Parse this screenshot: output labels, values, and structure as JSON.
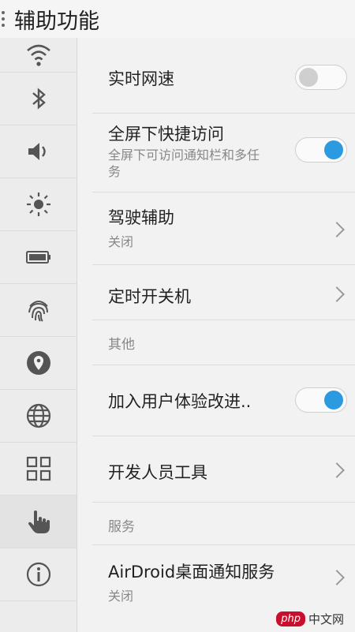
{
  "header": {
    "title": "辅助功能"
  },
  "sidebar": {
    "items": [
      {
        "icon": "wifi-icon"
      },
      {
        "icon": "bluetooth-icon"
      },
      {
        "icon": "volume-icon"
      },
      {
        "icon": "brightness-icon"
      },
      {
        "icon": "battery-icon"
      },
      {
        "icon": "fingerprint-icon"
      },
      {
        "icon": "location-icon"
      },
      {
        "icon": "globe-icon"
      },
      {
        "icon": "apps-grid-icon"
      },
      {
        "icon": "hand-pointer-icon",
        "active": true
      },
      {
        "icon": "info-icon"
      }
    ]
  },
  "rows": {
    "realtime_speed": {
      "label": "实时网速",
      "toggle": "off"
    },
    "fullscreen_access": {
      "label": "全屏下快捷访问",
      "sub": "全屏下可访问通知栏和多任务",
      "toggle": "on"
    },
    "driving_assist": {
      "label": "驾驶辅助",
      "sub": "关闭"
    },
    "scheduled_power": {
      "label": "定时开关机"
    },
    "section_other": "其他",
    "ux_program": {
      "label": "加入用户体验改进..",
      "toggle": "on"
    },
    "developer_tools": {
      "label": "开发人员工具"
    },
    "section_service": "服务",
    "airdroid": {
      "label": "AirDroid桌面通知服务",
      "sub": "关闭"
    }
  },
  "watermark": {
    "logo": "php",
    "text": "中文网"
  },
  "colors": {
    "accent": "#2b9ae0",
    "toggle_off": "#cfcfcf"
  }
}
